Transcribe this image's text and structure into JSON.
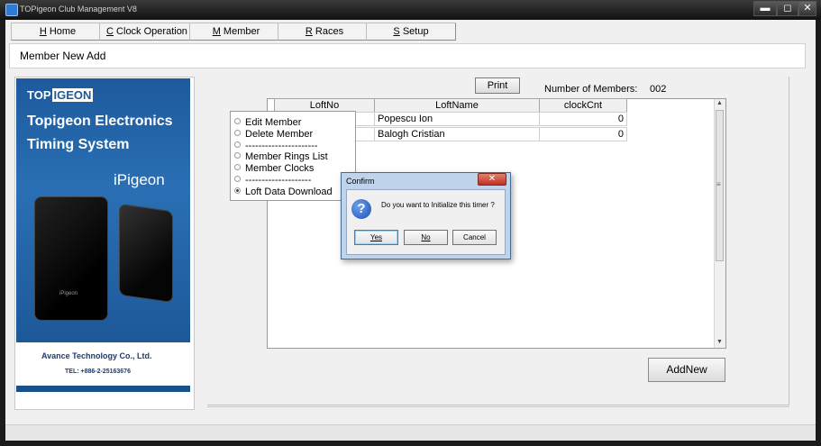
{
  "window": {
    "title": "TOPigeon Club Management V8",
    "min_glyph": "▬",
    "max_glyph": "◻",
    "close_glyph": "✕"
  },
  "menu": [
    {
      "key": "H",
      "label": " Home"
    },
    {
      "key": "C",
      "label": " Clock Operation"
    },
    {
      "key": "M",
      "label": " Member"
    },
    {
      "key": "R",
      "label": " Races"
    },
    {
      "key": "S",
      "label": " Setup"
    }
  ],
  "form": {
    "title": "Member New Add"
  },
  "banner": {
    "logo_prefix": "TOP",
    "logo_box": "IGEON",
    "title_line1": "Topigeon Electronics",
    "title_line2": "Timing System",
    "product": "iPigeon",
    "device_label": "iPigeon",
    "company": "Avance Technology Co., Ltd.",
    "tel": "TEL: +886-2-25163676"
  },
  "toolbar": {
    "print_label": "Print",
    "members_label": "Number of Members:",
    "members_count": "002"
  },
  "grid": {
    "columns": [
      "LoftNo",
      "LoftName",
      "clockCnt"
    ],
    "rows": [
      {
        "loftno": "",
        "loftname": "Popescu Ion",
        "clockcnt": "0"
      },
      {
        "loftno": "",
        "loftname": "Balogh Cristian",
        "clockcnt": "0"
      }
    ]
  },
  "options": [
    {
      "label": "Edit Member",
      "selected": false
    },
    {
      "label": "Delete Member",
      "selected": false
    },
    {
      "label": "----------------------",
      "selected": false
    },
    {
      "label": "Member Rings List",
      "selected": false
    },
    {
      "label": "Member Clocks",
      "selected": false
    },
    {
      "label": "--------------------",
      "selected": false
    },
    {
      "label": "Loft Data Download",
      "selected": true
    }
  ],
  "dialog": {
    "title": "Confirm",
    "close_glyph": "✕",
    "message": "Do you want to Initialize this timer ?",
    "icon": "?",
    "yes_label": "Yes",
    "no_label": "No",
    "cancel_label": "Cancel"
  },
  "scrollbar": {
    "up": "▲",
    "grip": "≡",
    "down": "▼"
  },
  "buttons": {
    "addnew_label": "AddNew"
  }
}
